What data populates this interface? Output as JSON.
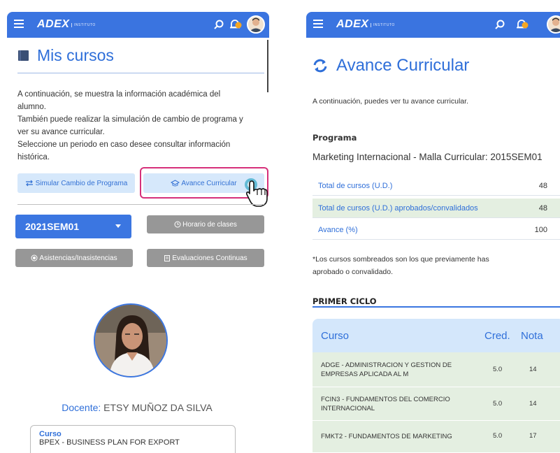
{
  "brand": {
    "logo": "ADEX",
    "logo_sub": "INSTITUTO"
  },
  "left": {
    "title": "Mis cursos",
    "paragraph_lines": [
      "A continuación, se muestra la información académica del",
      "alumno.",
      "También puede realizar la simulación de cambio de programa y",
      "ver su avance curricular.",
      "Seleccione un periodo en caso desee consultar información",
      "histórica."
    ],
    "btn_simular": "Simular Cambio de Programa",
    "btn_avance": "Avance Curricular",
    "period_value": "2021SEM01",
    "btn_horario": "Horario de clases",
    "btn_asistencias": "Asistencias/Inasistencias",
    "btn_evaluaciones": "Evaluaciones Continuas",
    "teacher_label": "Docente:",
    "teacher_name": "ETSY MUÑOZ DA SILVA",
    "course_label": "Curso",
    "course_value": "BPEX - BUSINESS PLAN FOR EXPORT"
  },
  "right": {
    "title": "Avance Curricular",
    "intro": "A continuación, puedes ver tu avance curricular.",
    "programa_label": "Programa",
    "programa_value": "Marketing Internacional - Malla Curricular: 2015SEM01",
    "stats": [
      {
        "label": "Total de cursos (U.D.)",
        "value": "48"
      },
      {
        "label": "Total de cursos (U.D.) aprobados/convalidados",
        "value": "48"
      },
      {
        "label": "Avance (%)",
        "value": "100"
      }
    ],
    "note_lines": [
      "*Los cursos sombreados son los que previamente has",
      "aprobado o convalidado."
    ],
    "section": "PRIMER CICLO",
    "table": {
      "headers": {
        "course": "Curso",
        "cred": "Cred.",
        "nota": "Nota"
      },
      "rows": [
        {
          "name_lines": [
            "ADGE - ADMINISTRACION Y GESTION DE",
            "EMPRESAS APLICADA AL M"
          ],
          "cred": "5.0",
          "nota": "14"
        },
        {
          "name_lines": [
            "FCIN3 - FUNDAMENTOS DEL COMERCIO",
            "INTERNACIONAL"
          ],
          "cred": "5.0",
          "nota": "14"
        },
        {
          "name_lines": [
            "FMKT2 - FUNDAMENTOS DE MARKETING"
          ],
          "cred": "5.0",
          "nota": "17"
        }
      ]
    }
  },
  "colors": {
    "primary": "#3a74e0",
    "light_blue": "#d6e8fb",
    "approved_row": "#e4efe1",
    "highlight": "#d6307a",
    "notification": "#f5a623"
  }
}
